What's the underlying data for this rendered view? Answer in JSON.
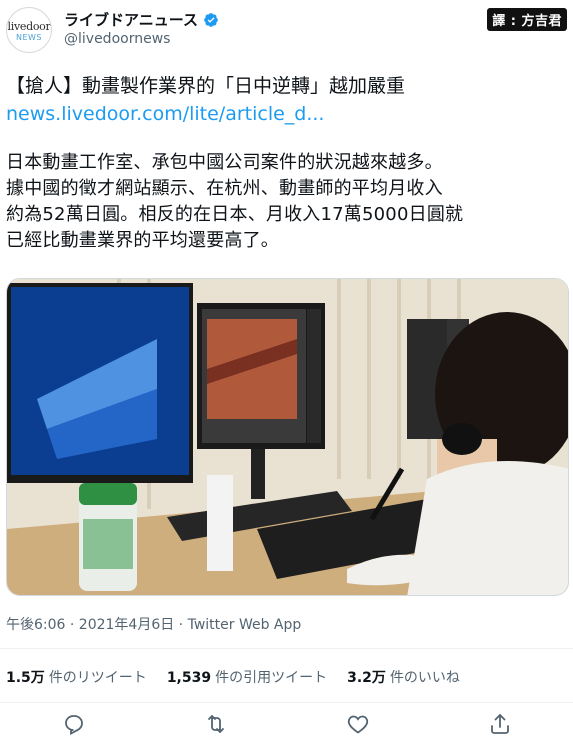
{
  "header": {
    "avatar_line1": "livedoor",
    "avatar_line2": "NEWS",
    "display_name": "ライブドアニュース",
    "handle": "@livedoornews",
    "watermark": "譯 : 方吉君",
    "verified_color": "#1d9bf0"
  },
  "tweet": {
    "headline": "【搶人】動畫製作業界的「日中逆轉」越加嚴重",
    "link": "news.livedoor.com/lite/article_d...",
    "body_lines": [
      "日本動畫工作室、承包中國公司案件的狀況越來越多。",
      "據中國的徵才網站顯示、在杭州、動畫師的平均月收入",
      "約為52萬日圓。相反的在日本、月收入17萬5000日圓就",
      "已經比動畫業界的平均還要高了。"
    ],
    "photo_label": "photo"
  },
  "meta": {
    "timestamp": "午後6:06 · 2021年4月6日 · Twitter Web App"
  },
  "stats": {
    "retweets_count": "1.5万",
    "retweets_label": "件のリツイート",
    "quotes_count": "1,539",
    "quotes_label": "件の引用ツイート",
    "likes_count": "3.2万",
    "likes_label": "件のいいね"
  },
  "actions": {
    "icons": [
      "reply-icon",
      "retweet-icon",
      "like-icon",
      "share-icon"
    ]
  },
  "colors": {
    "link": "#1d9bf0",
    "secondary_text": "#536471",
    "primary_text": "#0f1419"
  }
}
